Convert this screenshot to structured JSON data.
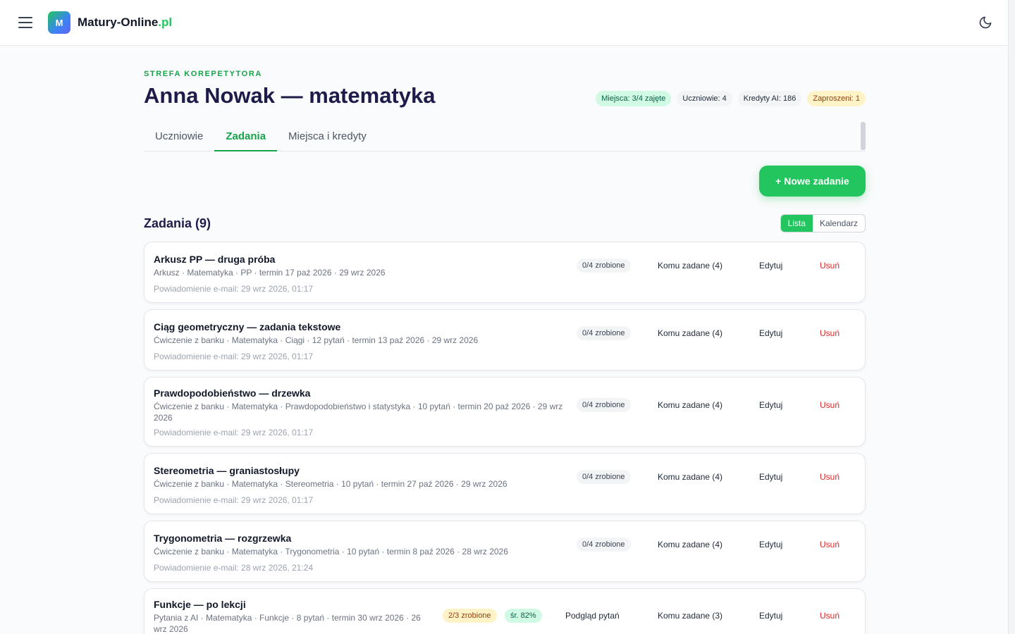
{
  "header": {
    "brand_name": "Matury-Online",
    "brand_suffix": ".pl",
    "logo_letter": "M"
  },
  "page": {
    "eyebrow": "STREFA KOREPETYTORA",
    "title": "Anna Nowak — matematyka",
    "badges": [
      {
        "label": "Miejsca: 3/4 zajęte",
        "tone": "green"
      },
      {
        "label": "Uczniowie: 4",
        "tone": "gray"
      },
      {
        "label": "Kredyty AI: 186",
        "tone": "gray"
      },
      {
        "label": "Zaproszeni: 1",
        "tone": "yellow"
      }
    ],
    "tabs": [
      {
        "label": "Uczniowie",
        "active": false
      },
      {
        "label": "Zadania",
        "active": true
      },
      {
        "label": "Miejsca i kredyty",
        "active": false
      }
    ],
    "new_button": "+ Nowe zadanie",
    "section_title": "Zadania (9)",
    "view_toggle": {
      "list": "Lista",
      "calendar": "Kalendarz",
      "selected": "Lista"
    }
  },
  "tasks": [
    {
      "title": "Arkusz PP — druga próba",
      "meta": "Arkusz · Matematyka · PP · termin 17 paź 2026 · 29 wrz 2026",
      "notif": "Powiadomienie e-mail: 29 wrz 2026, 01:17",
      "progress": "0/4 zrobione",
      "assigned": "Komu zadane (4)",
      "edit": "Edytuj",
      "delete": "Usuń"
    },
    {
      "title": "Ciąg geometryczny — zadania tekstowe",
      "meta": "Ćwiczenie z banku · Matematyka · Ciągi · 12 pytań · termin 13 paź 2026 · 29 wrz 2026",
      "notif": "Powiadomienie e-mail: 29 wrz 2026, 01:17",
      "progress": "0/4 zrobione",
      "assigned": "Komu zadane (4)",
      "edit": "Edytuj",
      "delete": "Usuń"
    },
    {
      "title": "Prawdopodobieństwo — drzewka",
      "meta": "Ćwiczenie z banku · Matematyka · Prawdopodobieństwo i statystyka · 10 pytań · termin 20 paź 2026 · 29 wrz 2026",
      "notif": "Powiadomienie e-mail: 29 wrz 2026, 01:17",
      "progress": "0/4 zrobione",
      "assigned": "Komu zadane (4)",
      "edit": "Edytuj",
      "delete": "Usuń"
    },
    {
      "title": "Stereometria — graniastosłupy",
      "meta": "Ćwiczenie z banku · Matematyka · Stereometria · 10 pytań · termin 27 paź 2026 · 29 wrz 2026",
      "notif": "Powiadomienie e-mail: 29 wrz 2026, 01:17",
      "progress": "0/4 zrobione",
      "assigned": "Komu zadane (4)",
      "edit": "Edytuj",
      "delete": "Usuń"
    },
    {
      "title": "Trygonometria — rozgrzewka",
      "meta": "Ćwiczenie z banku · Matematyka · Trygonometria · 10 pytań · termin 8 paź 2026 · 28 wrz 2026",
      "notif": "Powiadomienie e-mail: 28 wrz 2026, 21:24",
      "progress": "0/4 zrobione",
      "assigned": "Komu zadane (4)",
      "edit": "Edytuj",
      "delete": "Usuń"
    },
    {
      "title": "Funkcje — po lekcji",
      "meta": "Pytania z AI · Matematyka · Funkcje · 8 pytań · termin 30 wrz 2026 · 26 wrz 2026",
      "progress": "2/3 zrobione",
      "average": "śr. 82%",
      "preview": "Podgląd pytań",
      "assigned": "Komu zadane (3)",
      "edit": "Edytuj",
      "delete": "Usuń"
    }
  ]
}
